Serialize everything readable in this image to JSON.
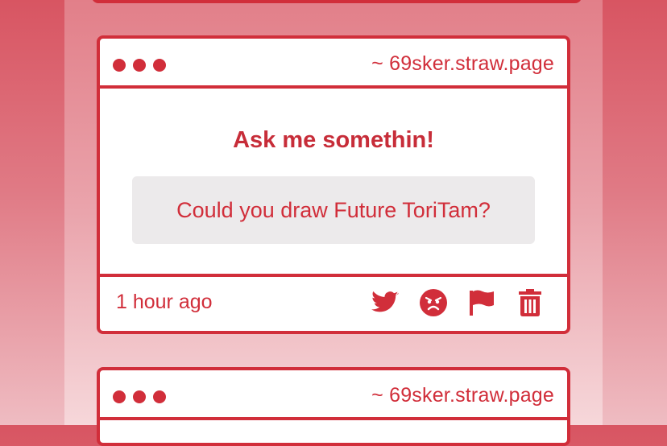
{
  "cards": [
    {
      "site": "~ 69sker.straw.page",
      "title": "Ask me somethin!",
      "question": "Could you draw Future ToriTam?",
      "time": "1 hour ago",
      "actions": [
        "twitter-icon",
        "angry-face-icon",
        "flag-icon",
        "trash-icon"
      ]
    },
    {
      "site": "~ 69sker.straw.page"
    }
  ],
  "colors": {
    "accent": "#d12e3a",
    "question_bg": "#eceaeb",
    "background_top": "#d85562",
    "background_bottom": "#efbcc2"
  }
}
